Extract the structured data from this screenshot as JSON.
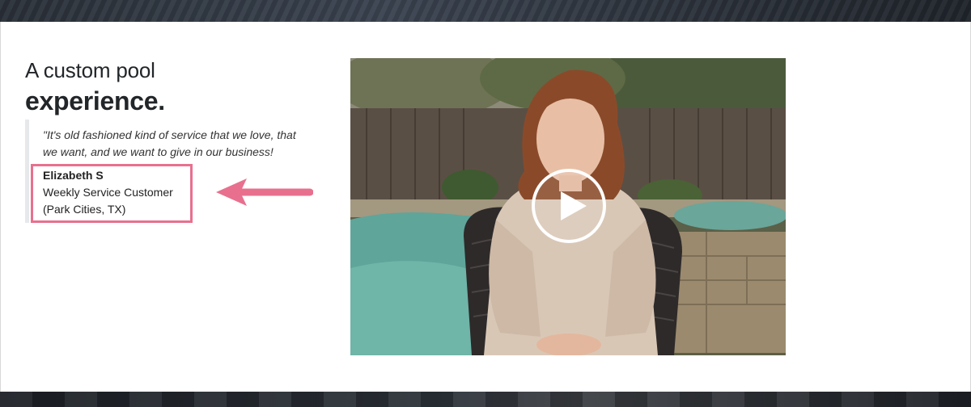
{
  "heading": {
    "line1": "A custom pool",
    "line2": "experience."
  },
  "testimonial": {
    "quote": "\"It's old fashioned kind of service that we love, that we want, and we want to give in our business!",
    "author_name": "Elizabeth S",
    "author_role": "Weekly Service Customer",
    "author_location": "(Park Cities, TX)"
  },
  "video": {
    "play_icon": "play-icon",
    "thumbnail": "woman-seated-by-pool"
  },
  "colors": {
    "highlight": "#e8708e",
    "heading_text": "#222629",
    "banner_dark": "#2a3038"
  }
}
